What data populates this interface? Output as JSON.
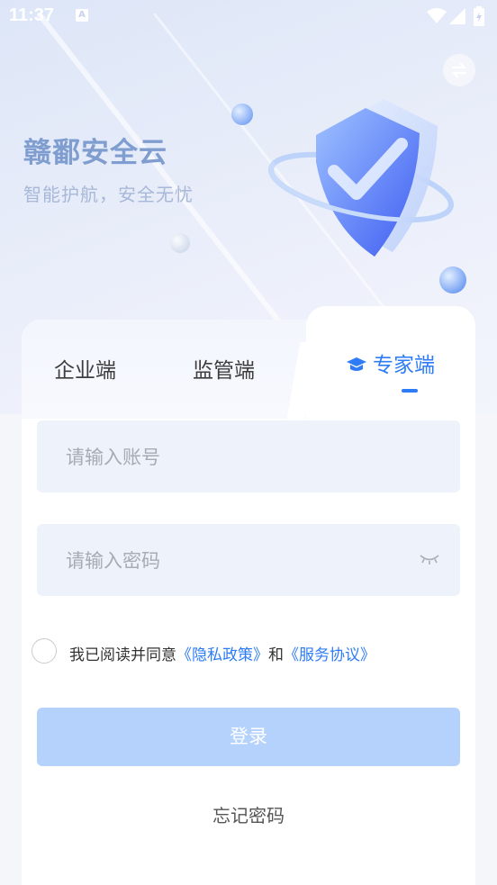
{
  "status_bar": {
    "time": "11:37",
    "notification_icon": "A"
  },
  "header": {
    "title": "赣鄱安全云",
    "slogan": "智能护航，安全无忧"
  },
  "tabs": [
    {
      "label": "企业端",
      "active": false
    },
    {
      "label": "监管端",
      "active": false
    },
    {
      "label": "专家端",
      "active": true
    }
  ],
  "form": {
    "account_placeholder": "请输入账号",
    "account_value": "",
    "password_placeholder": "请输入密码",
    "password_value": ""
  },
  "agreement": {
    "prefix": "我已阅读并同意",
    "privacy_link": "《隐私政策》",
    "and": "和",
    "service_link": "《服务协议》",
    "checked": false
  },
  "login_label": "登录",
  "forgot_label": "忘记密码",
  "colors": {
    "accent": "#2d7cf6",
    "button_disabled": "#b5d2fd",
    "title": "#7f9dcf"
  }
}
